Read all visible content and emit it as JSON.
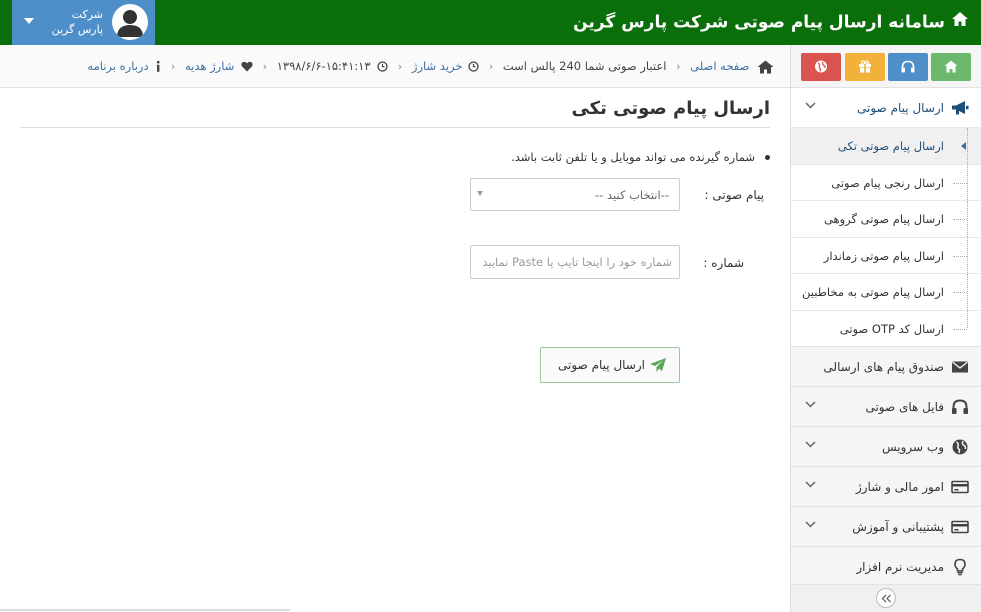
{
  "header": {
    "title": "سامانه ارسال پیام صوتی شرکت پارس گرین",
    "user_line1": "شرکت",
    "user_line2": "پارس گرین",
    "bg_color": "#0a6e0a",
    "user_bg": "#4e8fc9"
  },
  "breadcrumb": {
    "home": "صفحه اصلی",
    "credit": "اعتبار صوتی شما 240 پالس است",
    "buy": "خرید شارژ",
    "datetime": "۱۳۹۸/۶/۶-۱۵:۴۱:۱۳",
    "gift": "شارژ هدیه",
    "about": "درباره برنامه"
  },
  "shortcuts": [
    {
      "icon": "home-icon",
      "color": "#6cb86c"
    },
    {
      "icon": "headphones-icon",
      "color": "#4e8fc9"
    },
    {
      "icon": "gift-icon",
      "color": "#f2b23a"
    },
    {
      "icon": "globe-icon",
      "color": "#d9534f"
    }
  ],
  "sidebar": {
    "send_group": "ارسال پیام صوتی",
    "sub_items": [
      "ارسال پیام صوتی تکی",
      "ارسال رنجی پیام صوتی",
      "ارسال پیام صوتی گروهی",
      "ارسال پیام صوتی زماندار",
      "ارسال پیام صوتی به مخاطبین",
      "ارسال کد OTP صوتی"
    ],
    "outbox": "صندوق پیام های ارسالی",
    "audio_files": "فایل های صوتی",
    "webservice": "وب سرویس",
    "finance": "امور مالی و شارژ",
    "support": "پشتیبانی و آموزش",
    "software": "مدیریت نرم افزار"
  },
  "main": {
    "title": "ارسال پیام صوتی تکی",
    "note": "شماره گیرنده می تواند موبایل و یا تلفن ثابت باشد.",
    "voice_label": "پیام صوتی :",
    "voice_value": "--انتخاب کنید --",
    "number_label": "شماره :",
    "number_placeholder": "شماره خود را اینجا تایپ یا Paste نمایید",
    "send_label": "ارسال پیام صوتی"
  }
}
